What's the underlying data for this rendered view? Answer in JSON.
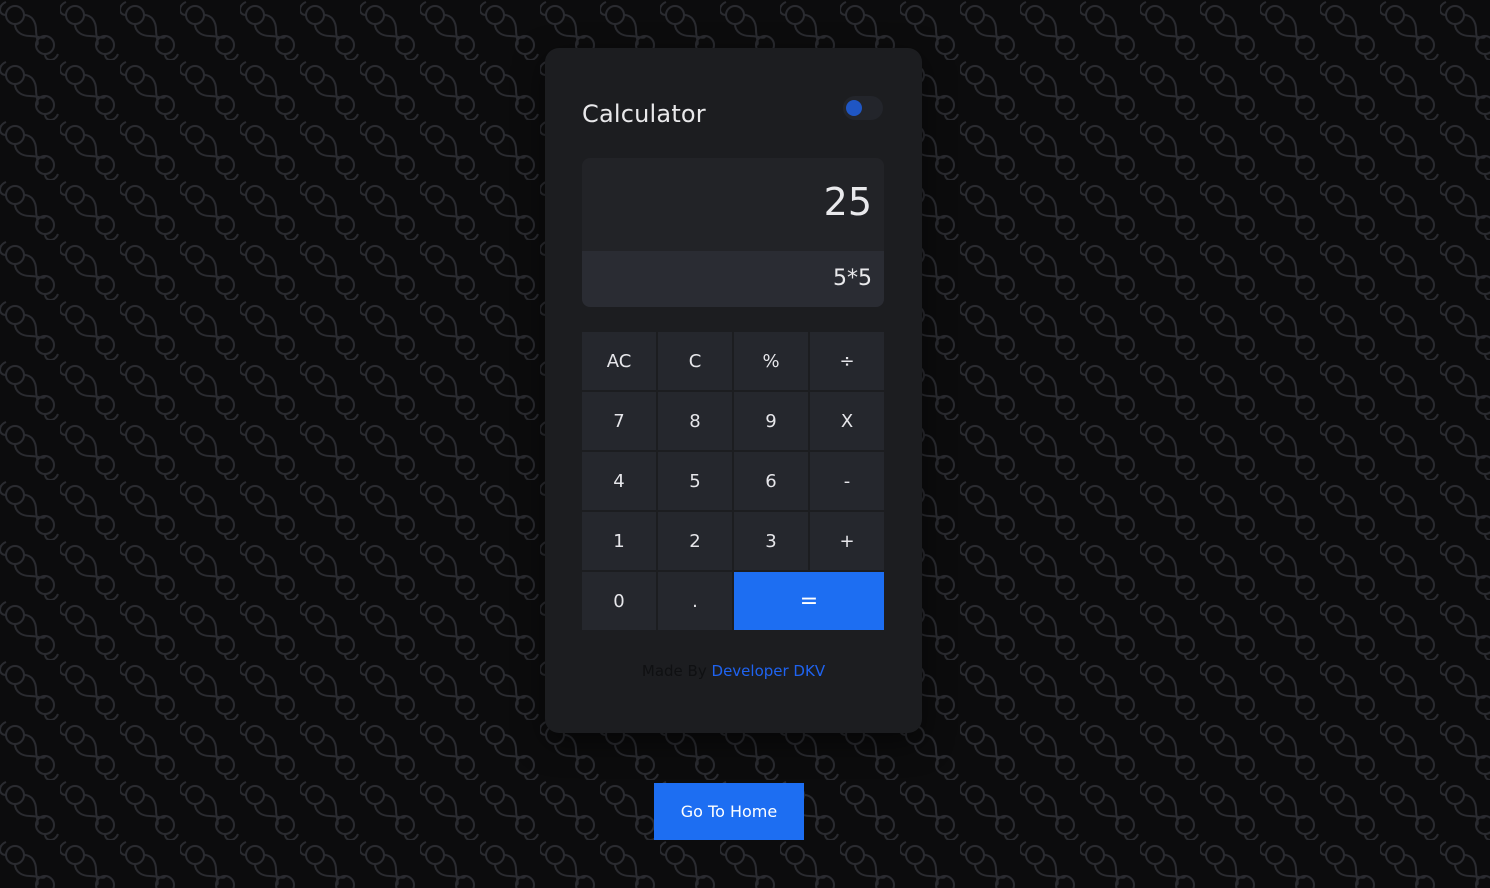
{
  "app": {
    "title": "Calculator"
  },
  "theme_toggle": {
    "state": "dark",
    "accent": "#1f56c4"
  },
  "display": {
    "result": "25",
    "expression": "5*5"
  },
  "keypad": {
    "keys": [
      {
        "label": "AC",
        "name": "all-clear-key"
      },
      {
        "label": "C",
        "name": "clear-key"
      },
      {
        "label": "%",
        "name": "percent-key"
      },
      {
        "label": "÷",
        "name": "divide-key"
      },
      {
        "label": "7",
        "name": "digit-7-key"
      },
      {
        "label": "8",
        "name": "digit-8-key"
      },
      {
        "label": "9",
        "name": "digit-9-key"
      },
      {
        "label": "X",
        "name": "multiply-key"
      },
      {
        "label": "4",
        "name": "digit-4-key"
      },
      {
        "label": "5",
        "name": "digit-5-key"
      },
      {
        "label": "6",
        "name": "digit-6-key"
      },
      {
        "label": "-",
        "name": "subtract-key"
      },
      {
        "label": "1",
        "name": "digit-1-key"
      },
      {
        "label": "2",
        "name": "digit-2-key"
      },
      {
        "label": "3",
        "name": "digit-3-key"
      },
      {
        "label": "+",
        "name": "add-key"
      },
      {
        "label": "0",
        "name": "digit-0-key"
      },
      {
        "label": ".",
        "name": "decimal-key"
      },
      {
        "label": "=",
        "name": "equals-key"
      }
    ]
  },
  "credit": {
    "prefix": "Made By",
    "author": "Developer DKV"
  },
  "home_button": {
    "label": "Go To Home"
  },
  "colors": {
    "accent": "#1d6ef2",
    "card": "#1c1d20",
    "background": "#0c0c0d"
  }
}
